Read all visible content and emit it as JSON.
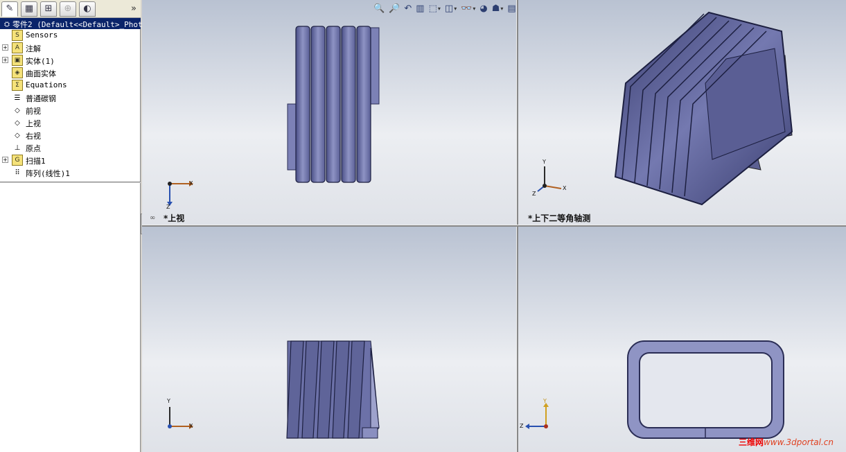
{
  "panel": {
    "tabs": [
      {
        "name": "feature-manager-tab-icon",
        "glyph": "✎"
      },
      {
        "name": "property-manager-tab-icon",
        "glyph": "▦"
      },
      {
        "name": "configuration-manager-tab-icon",
        "glyph": "⊞"
      },
      {
        "name": "dimxpert-tab-icon",
        "glyph": "⊕"
      },
      {
        "name": "display-manager-tab-icon",
        "glyph": "◐"
      }
    ],
    "more": "»"
  },
  "tree": {
    "root": "零件2  (Default<<Default>_Phot",
    "items": [
      {
        "label": "Sensors",
        "icon": "S",
        "expander": ""
      },
      {
        "label": "注解",
        "icon": "A",
        "expander": "+"
      },
      {
        "label": "实体(1)",
        "icon": "▣",
        "expander": "+"
      },
      {
        "label": "曲面实体",
        "icon": "◈",
        "expander": ""
      },
      {
        "label": "Equations",
        "icon": "Σ",
        "expander": ""
      },
      {
        "label": "普通碳钢",
        "icon": "☰",
        "expander": ""
      },
      {
        "label": "前视",
        "icon": "◇",
        "expander": ""
      },
      {
        "label": "上视",
        "icon": "◇",
        "expander": ""
      },
      {
        "label": "右视",
        "icon": "◇",
        "expander": ""
      },
      {
        "label": "原点",
        "icon": "⊥",
        "expander": ""
      },
      {
        "label": "扫描1",
        "icon": "G",
        "expander": "+"
      },
      {
        "label": "阵列(线性)1",
        "icon": "⠿",
        "expander": ""
      }
    ]
  },
  "toolbar": {
    "buttons": [
      {
        "name": "zoom-to-fit-icon",
        "glyph": "🔍",
        "dropdown": false
      },
      {
        "name": "zoom-to-area-icon",
        "glyph": "🔎",
        "dropdown": false
      },
      {
        "name": "previous-view-icon",
        "glyph": "↶",
        "dropdown": false
      },
      {
        "name": "section-view-icon",
        "glyph": "▥",
        "dropdown": false
      },
      {
        "name": "view-orientation-icon",
        "glyph": "⬚",
        "dropdown": true
      },
      {
        "name": "display-style-icon",
        "glyph": "◫",
        "dropdown": true
      },
      {
        "name": "hide-show-items-icon",
        "glyph": "👓",
        "dropdown": true
      },
      {
        "name": "edit-appearance-icon",
        "glyph": "◕",
        "dropdown": false
      },
      {
        "name": "apply-scene-icon",
        "glyph": "☗",
        "dropdown": true
      },
      {
        "name": "view-settings-icon",
        "glyph": "▤",
        "dropdown": true
      }
    ]
  },
  "views": {
    "top": {
      "label": "*上视",
      "axis_x": "X",
      "axis_z": "Z"
    },
    "iso": {
      "label": "*上下二等角轴测",
      "axis_x": "X",
      "axis_y": "Y",
      "axis_z": "Z"
    },
    "front": {
      "axis_x": "X",
      "axis_y": "Y"
    },
    "right": {
      "axis_y": "Y",
      "axis_z": "Z"
    }
  },
  "colors": {
    "model_fill": "#6f74a8",
    "model_dark": "#2a2d55",
    "model_light": "#a0a4cc",
    "root_highlight": "#0a246a"
  },
  "watermark": {
    "cn": "三维网",
    "url": "www.3dportal.cn"
  }
}
